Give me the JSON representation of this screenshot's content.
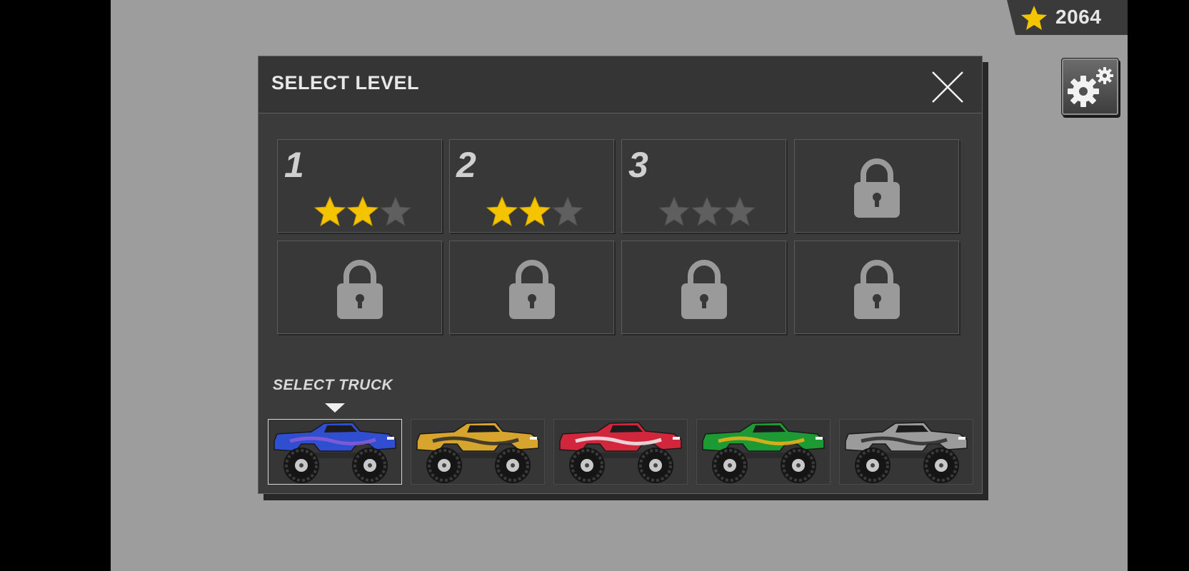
{
  "hud": {
    "coins": "2064",
    "star_color": "#f5c400",
    "settings_icon": "gear-icon"
  },
  "dialog": {
    "title": "SELECT LEVEL",
    "close_icon": "close-icon"
  },
  "levels": [
    {
      "label": "1",
      "unlocked": true,
      "stars": 2
    },
    {
      "label": "2",
      "unlocked": true,
      "stars": 2
    },
    {
      "label": "3",
      "unlocked": true,
      "stars": 0
    },
    {
      "label": "",
      "unlocked": false,
      "stars": 0
    },
    {
      "label": "",
      "unlocked": false,
      "stars": 0
    },
    {
      "label": "",
      "unlocked": false,
      "stars": 0
    },
    {
      "label": "",
      "unlocked": false,
      "stars": 0
    },
    {
      "label": "",
      "unlocked": false,
      "stars": 0
    }
  ],
  "trucks": {
    "label": "SELECT TRUCK",
    "selected_index": 0,
    "items": [
      {
        "name": "blue",
        "body": "#2f4fd0",
        "accent": "#8a5ad8"
      },
      {
        "name": "yellow",
        "body": "#d7a52e",
        "accent": "#2a2a2a"
      },
      {
        "name": "red",
        "body": "#d2263c",
        "accent": "#f0f0f0"
      },
      {
        "name": "green",
        "body": "#1d9a34",
        "accent": "#f2b318"
      },
      {
        "name": "silver",
        "body": "#9b9b9b",
        "accent": "#2a2a2a"
      }
    ]
  }
}
